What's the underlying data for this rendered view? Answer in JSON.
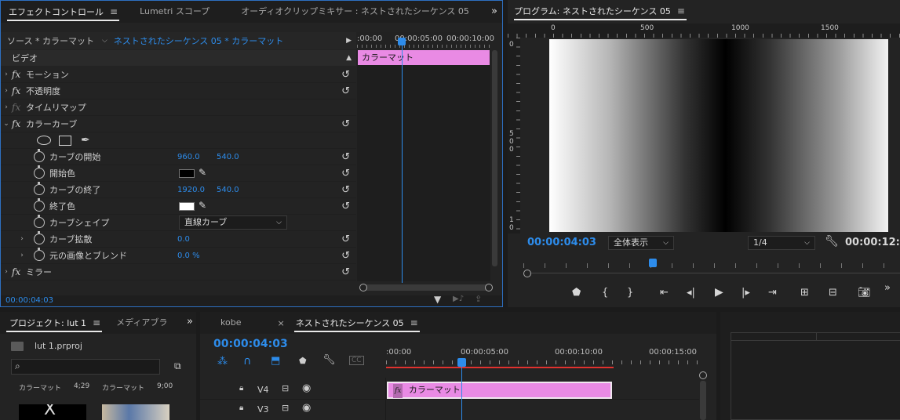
{
  "effect_controls": {
    "tabs": [
      {
        "label": "エフェクトコントロール"
      },
      {
        "label": "Lumetri スコープ"
      },
      {
        "label": "オーディオクリップミキサー : ネストされたシーケンス 05"
      }
    ],
    "source_label": "ソース * カラーマット",
    "sequence_label": "ネストされたシーケンス 05 * カラーマット",
    "ruler": {
      "t0": ":00:00",
      "t1": "00:00:05:00",
      "t2": "00:00:10:00"
    },
    "clip_label": "カラーマット",
    "section_video": "ビデオ",
    "rows": {
      "motion": "モーション",
      "opacity": "不透明度",
      "time_remap": "タイムリマップ",
      "color_curves": "カラーカーブ",
      "curve_start": "カーブの開始",
      "start_color": "開始色",
      "curve_end": "カーブの終了",
      "end_color": "終了色",
      "curve_shape": "カーブシェイプ",
      "curve_spread": "カーブ拡散",
      "blend": "元の画像とブレンド",
      "mirror": "ミラー"
    },
    "values": {
      "curve_start_x": "960.0",
      "curve_start_y": "540.0",
      "curve_end_x": "1920.0",
      "curve_end_y": "540.0",
      "curve_shape": "直線カーブ",
      "curve_spread": "0.0",
      "blend": "0.0 %"
    },
    "start_color_hex": "#000000",
    "end_color_hex": "#ffffff",
    "timecode": "00:00:04:03"
  },
  "program": {
    "title": "プログラム: ネストされたシーケンス 05",
    "ruler_labels": {
      "r0": "0",
      "r500": "500",
      "r1000": "1000",
      "r1500": "1500"
    },
    "v_labels": {
      "v0": "0",
      "v500": "5 0 0",
      "v1000": "1 0"
    },
    "timecode": "00:00:04:03",
    "fit": "全体表示",
    "resolution": "1/4",
    "duration": "00:00:12:0"
  },
  "project": {
    "tab_project": "プロジェクト: lut 1",
    "tab_media": "メディアブラ",
    "file": "lut 1.prproj",
    "thumb1_name": "カラーマット",
    "thumb1_dur": "4;29",
    "thumb2_name": "カラーマット",
    "thumb2_dur": "9;00"
  },
  "timeline": {
    "tab_kobe": "kobe",
    "tab_seq": "ネストされたシーケンス 05",
    "timecode": "00:00:04:03",
    "ruler": {
      "t0": ":00:00",
      "t5": "00:00:05:00",
      "t10": "00:00:10:00",
      "t15": "00:00:15:00"
    },
    "tracks": [
      {
        "name": "V4"
      },
      {
        "name": "V3"
      }
    ],
    "clip_label": "カラーマット",
    "clip_color": "#e98ae4"
  },
  "colors": {
    "accent": "#2d8ceb",
    "clip": "#e98ae4",
    "playhead": "#2d8ceb"
  }
}
